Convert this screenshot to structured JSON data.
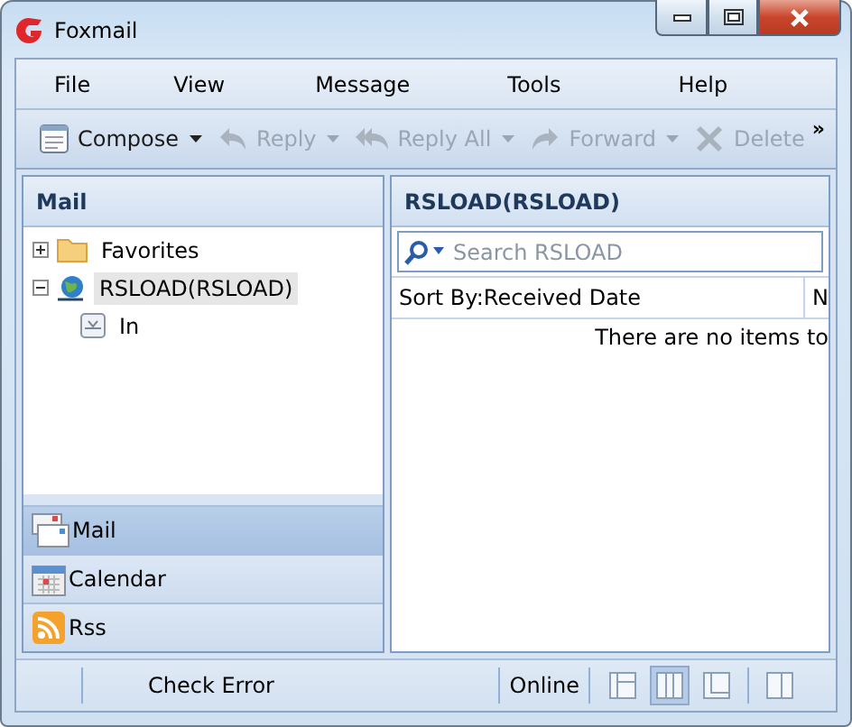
{
  "window": {
    "title": "Foxmail"
  },
  "menu": [
    "File",
    "View",
    "Message",
    "Tools",
    "Help"
  ],
  "toolbar": {
    "buttons": [
      {
        "kind": "compose",
        "label": "Compose",
        "disabled": false,
        "dropdown": true
      },
      {
        "kind": "reply",
        "label": "Reply",
        "disabled": true,
        "dropdown": true
      },
      {
        "kind": "replyall",
        "label": "Reply All",
        "disabled": true,
        "dropdown": true
      },
      {
        "kind": "forward",
        "label": "Forward",
        "disabled": true,
        "dropdown": true
      },
      {
        "kind": "delete",
        "label": "Delete",
        "disabled": true,
        "dropdown": false
      }
    ],
    "overflow": "»"
  },
  "sidebar": {
    "title": "Mail",
    "tree": [
      {
        "kind": "folder",
        "label": "Favorites",
        "expanded": false,
        "selected": false
      },
      {
        "kind": "account",
        "label": "RSLOAD(RSLOAD)",
        "expanded": true,
        "selected": true,
        "children": [
          {
            "kind": "inbox",
            "label": "In",
            "selected": false
          }
        ]
      }
    ],
    "nav": [
      {
        "kind": "mail",
        "label": "Mail",
        "selected": true
      },
      {
        "kind": "calendar",
        "label": "Calendar",
        "selected": false
      },
      {
        "kind": "rss",
        "label": "Rss",
        "selected": false
      }
    ]
  },
  "list": {
    "title": "RSLOAD(RSLOAD)",
    "search": {
      "placeholder": "Search RSLOAD"
    },
    "columns": [
      "Sort By:Received Date",
      "N"
    ],
    "empty_message": "There are no items to"
  },
  "status_bar": {
    "message": "Check Error",
    "connection": "Online",
    "layouts": [
      {
        "kind": "split",
        "selected": false
      },
      {
        "kind": "columns",
        "selected": true
      },
      {
        "kind": "bottom",
        "selected": false
      },
      {
        "kind": "side",
        "selected": false
      }
    ]
  }
}
